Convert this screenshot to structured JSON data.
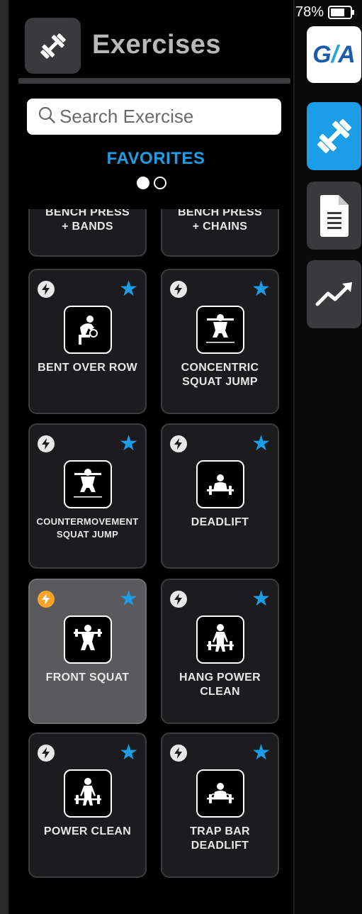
{
  "status": {
    "battery_text": "78%",
    "battery_level": 0.78
  },
  "header": {
    "title": "Exercises",
    "icon": "dumbbell-icon"
  },
  "search": {
    "placeholder": "Search Exercise",
    "value": ""
  },
  "section": {
    "title": "FAVORITES",
    "page_index": 0,
    "page_count": 2
  },
  "partial_exercises": [
    {
      "name": "BENCH PRESS\n+ BANDS"
    },
    {
      "name": "BENCH PRESS\n+ CHAINS"
    }
  ],
  "exercises": [
    {
      "name": "BENT OVER ROW",
      "icon": "bent-over-row-icon",
      "favorite": true,
      "power_active": false,
      "selected": false
    },
    {
      "name": "CONCENTRIC SQUAT JUMP",
      "icon": "squat-icon",
      "favorite": true,
      "power_active": false,
      "selected": false
    },
    {
      "name": "COUNTERMOVEMENT SQUAT JUMP",
      "icon": "squat-icon",
      "favorite": true,
      "power_active": false,
      "selected": false
    },
    {
      "name": "DEADLIFT",
      "icon": "deadlift-icon",
      "favorite": true,
      "power_active": false,
      "selected": false
    },
    {
      "name": "FRONT SQUAT",
      "icon": "front-squat-icon",
      "favorite": true,
      "power_active": true,
      "selected": true
    },
    {
      "name": "HANG POWER CLEAN",
      "icon": "power-clean-icon",
      "favorite": true,
      "power_active": false,
      "selected": false
    },
    {
      "name": "POWER CLEAN",
      "icon": "power-clean-icon",
      "favorite": true,
      "power_active": false,
      "selected": false
    },
    {
      "name": "TRAP BAR DEADLIFT",
      "icon": "trap-bar-deadlift-icon",
      "favorite": true,
      "power_active": false,
      "selected": false
    }
  ],
  "rail": {
    "logo_text": "G/A",
    "logo_left": "G",
    "logo_slash": "/",
    "logo_right": "A",
    "items": [
      {
        "name": "exercises",
        "icon": "dumbbell-icon",
        "active": true
      },
      {
        "name": "reports",
        "icon": "document-icon",
        "active": false
      },
      {
        "name": "progress",
        "icon": "trend-chart-icon",
        "active": false
      }
    ]
  },
  "colors": {
    "accent": "#1b9ee6",
    "power_active": "#f4a52a",
    "card_bg": "#1c1c1e",
    "card_selected_bg": "#5a5a5c",
    "title_gray": "#b8b8b8"
  }
}
